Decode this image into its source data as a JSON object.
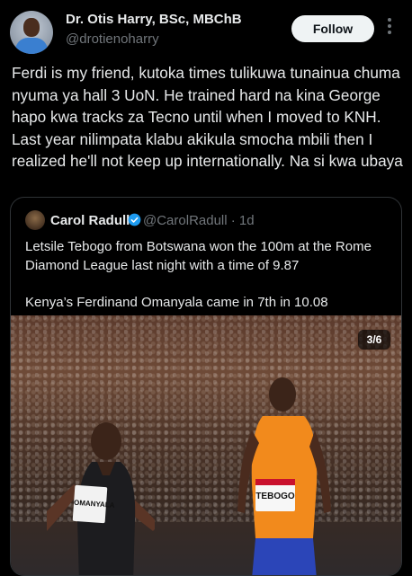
{
  "header": {
    "name": "Dr. Otis Harry, BSc, MBChB",
    "handle": "@drotienoharry",
    "follow_label": "Follow"
  },
  "post": {
    "text": "Ferdi is my friend, kutoka times tulikuwa tunainua chuma nyuma ya hall 3 UoN. He trained hard na kina George hapo kwa tracks za Tecno until when I moved to KNH. Last year nilimpata klabu akikula smocha mbili then I realized he'll not keep up internationally. Na si kwa ubaya"
  },
  "quote": {
    "name": "Carol Radull",
    "handle": "@CarolRadull · 1d",
    "paragraphs": [
      "Letsile Tebogo from Botswana won the 100m at the Rome Diamond League last night with a time of 9.87",
      "Kenya’s Ferdinand Omanyala came in 7th in 10.08"
    ],
    "media": {
      "counter": "3/6",
      "bib_left": "OMANYALA",
      "bib_right": "TEBOGO"
    },
    "verified_color": "#1d9bf0"
  },
  "icons": {
    "more": "more-vertical-icon",
    "verified": "verified-badge-icon"
  }
}
